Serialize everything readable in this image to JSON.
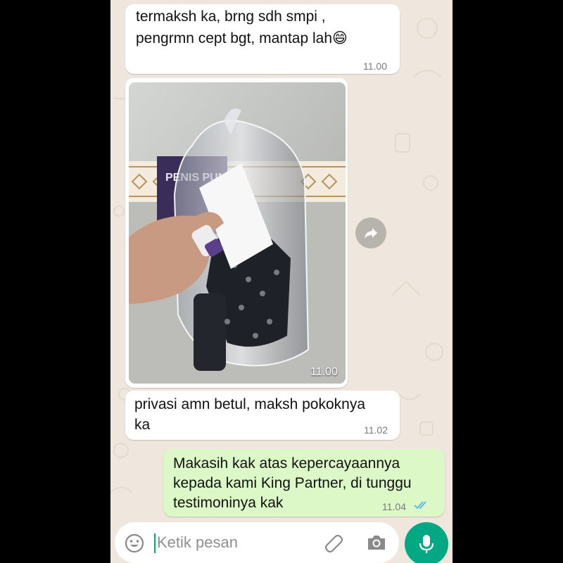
{
  "messages": [
    {
      "text": "termaksh ka, brng sdh smpi ,\npengrmn cept bgt, mantap lah😄",
      "time": "11.00",
      "direction": "in"
    },
    {
      "type": "image",
      "time": "11.00",
      "direction": "in",
      "image_text": "PENIS PUMP"
    },
    {
      "text": "privasi amn betul, maksh pokoknya\nka",
      "time": "11.02",
      "direction": "in"
    },
    {
      "text": "Makasih kak atas kepercayaannya\nkepada kami King Partner, di tunggu\ntestimoninya kak",
      "time": "11.04",
      "direction": "out",
      "status": "read"
    }
  ],
  "composer": {
    "placeholder": "Ketik pesan",
    "icons": [
      "emoji-icon",
      "attach-icon",
      "camera-icon",
      "mic-icon"
    ]
  },
  "icons": {
    "forward": "forward-icon",
    "read_receipt": "double-check-icon"
  },
  "colors": {
    "chat_bg": "#efe7dd",
    "incoming": "#ffffff",
    "outgoing": "#dcf8c6",
    "accent": "#00a884",
    "read_tick": "#4fb6ec"
  }
}
